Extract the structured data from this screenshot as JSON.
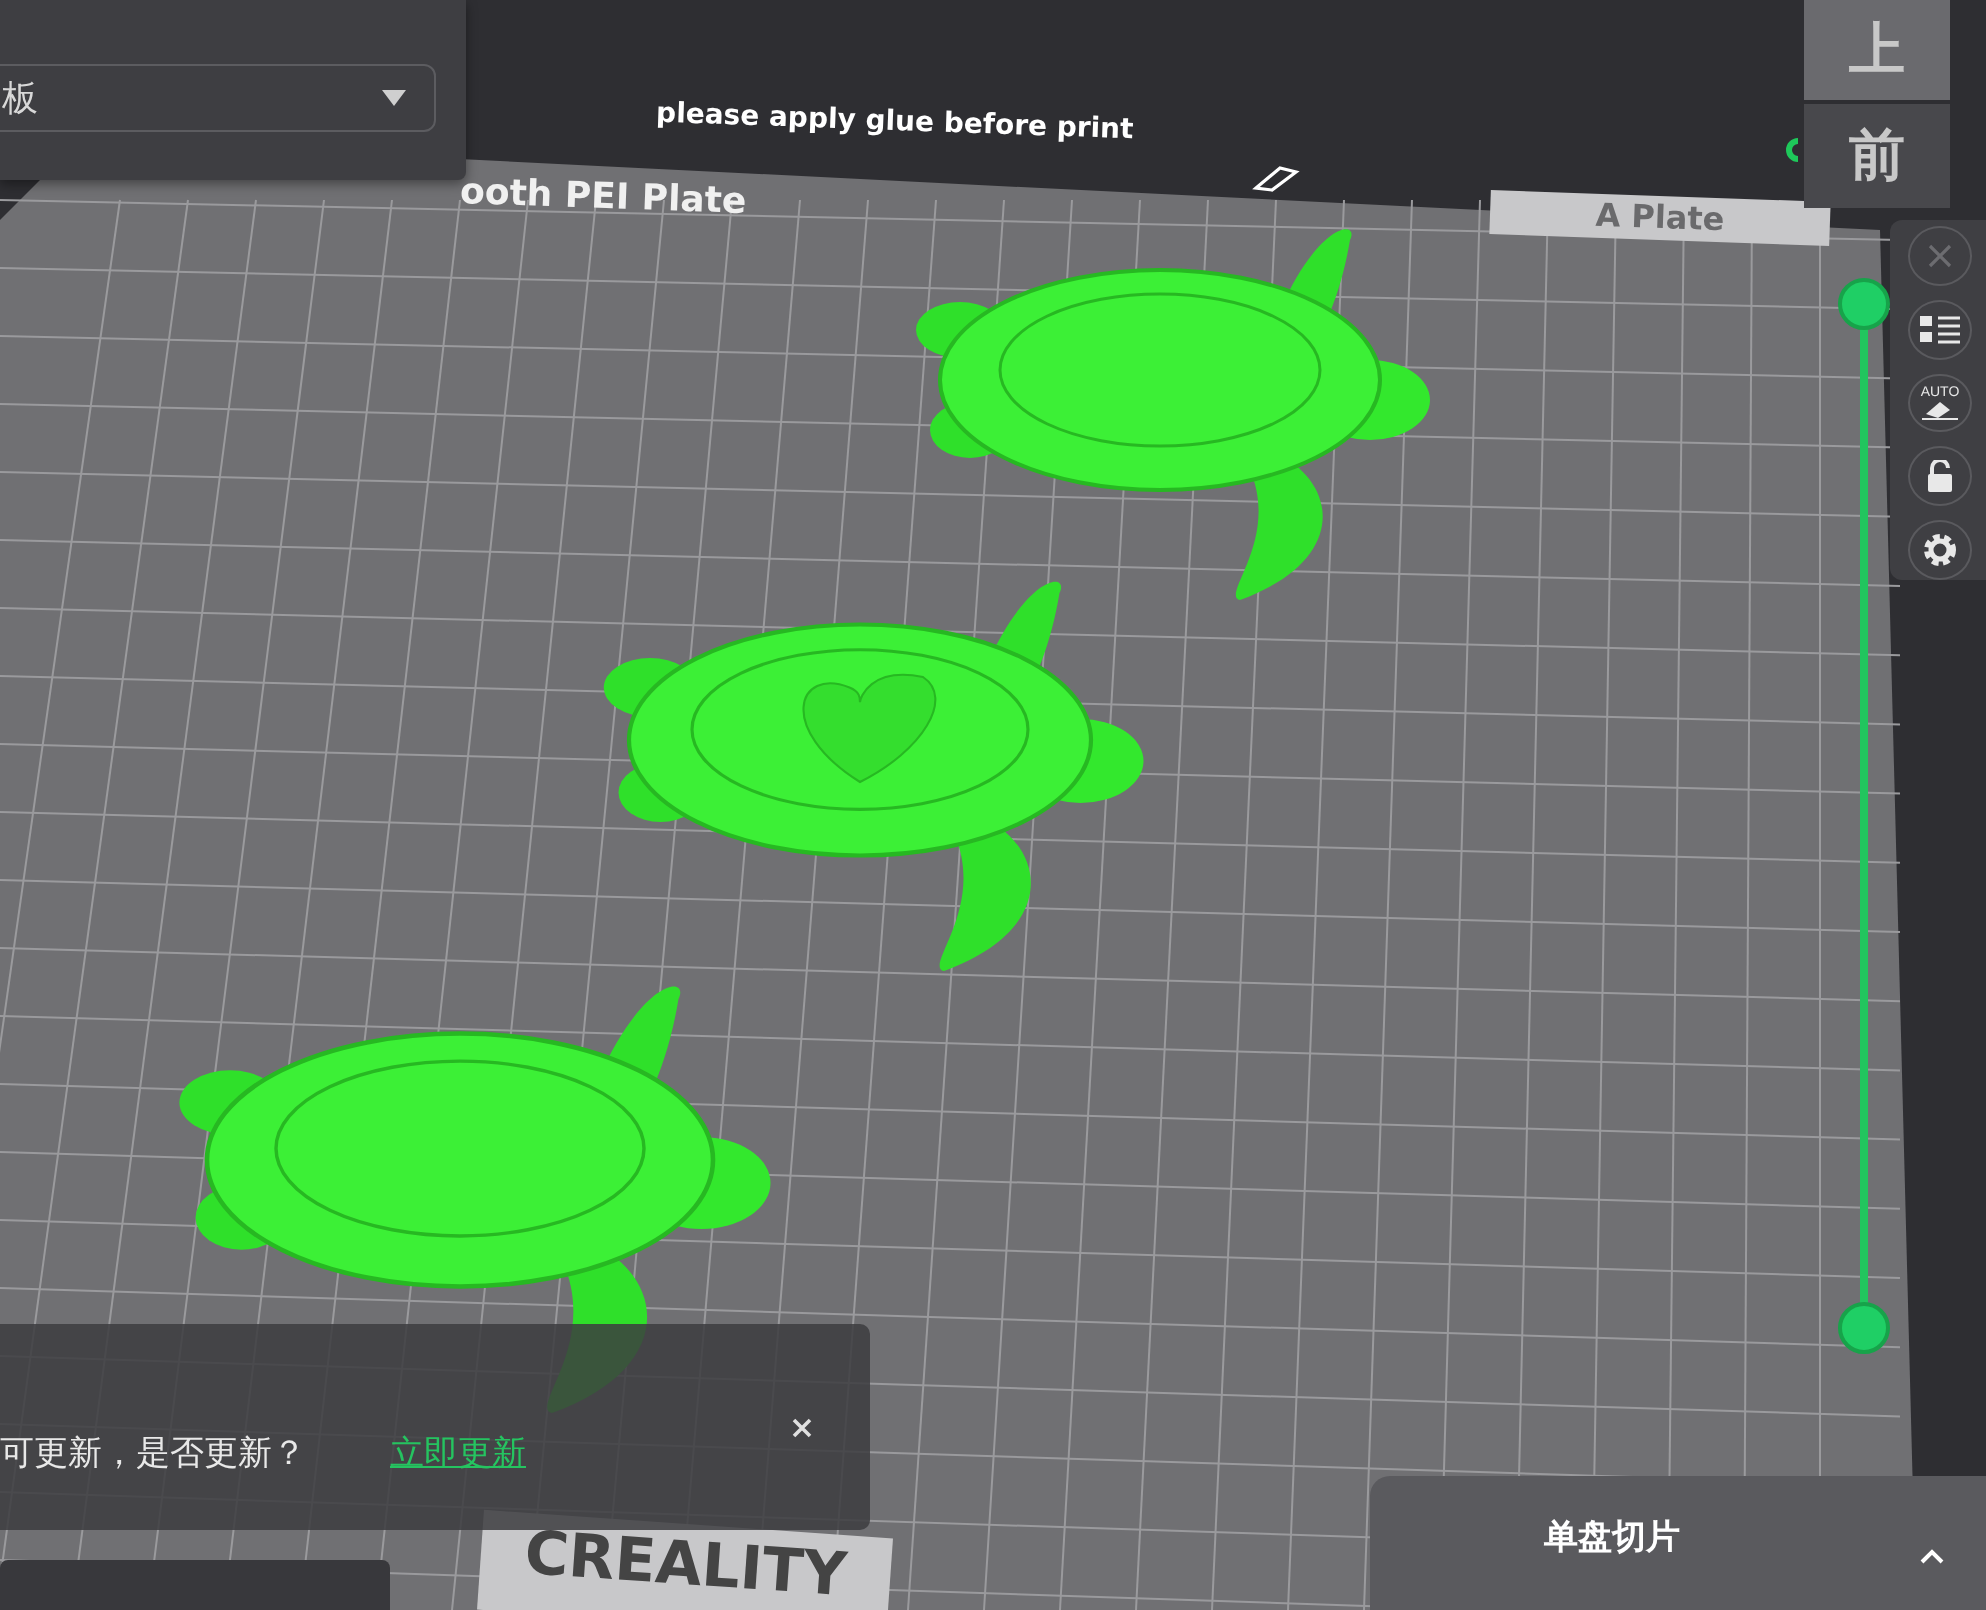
{
  "settings_panel": {
    "dropdown": {
      "value": "板"
    }
  },
  "build_plate": {
    "notice": "please apply glue before print",
    "plate_type": "ooth PEI Plate",
    "plate_name": "A Plate",
    "brand": "CREALITY"
  },
  "models": [
    {
      "kind": "turtle"
    },
    {
      "kind": "turtle-heart"
    },
    {
      "kind": "turtle"
    }
  ],
  "view_cube": {
    "top": "上",
    "front": "前"
  },
  "side_toolbar": [
    {
      "kind": "close",
      "disabled": true
    },
    {
      "kind": "list",
      "disabled": false
    },
    {
      "kind": "auto",
      "label": "AUTO",
      "disabled": false
    },
    {
      "kind": "lock",
      "disabled": false
    },
    {
      "kind": "gear",
      "disabled": false
    }
  ],
  "notification": {
    "message": "可更新，是否更新？",
    "link": "立即更新"
  },
  "slice_button": {
    "label": "单盘切片"
  }
}
